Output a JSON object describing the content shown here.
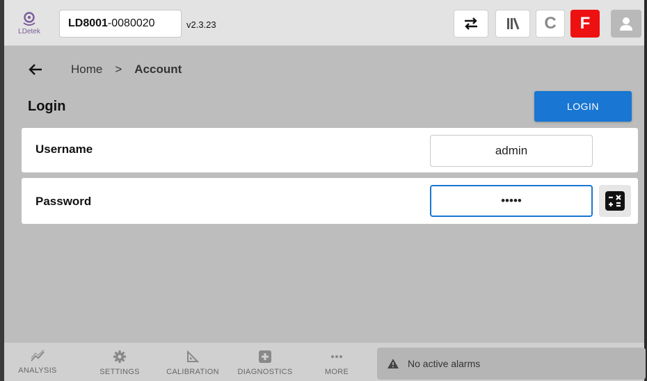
{
  "header": {
    "logo_text": "LDetek",
    "device_model": "LD8001",
    "device_serial": "-0080020",
    "version": "v2.3.23",
    "c_label": "C",
    "f_label": "F",
    "icons": [
      "swap-icon",
      "library-icon",
      "user-icon"
    ],
    "f_color": "#ee1111"
  },
  "breadcrumb": {
    "home": "Home",
    "separator": ">",
    "current": "Account"
  },
  "login": {
    "title": "Login",
    "button_label": "LOGIN",
    "username_label": "Username",
    "username_value": "admin",
    "password_label": "Password",
    "password_value": "•••••"
  },
  "bottom_nav": {
    "items": [
      {
        "label": "ANALYSIS",
        "icon": "chart-line-icon"
      },
      {
        "label": "SETTINGS",
        "icon": "gear-icon"
      },
      {
        "label": "CALIBRATION",
        "icon": "set-square-icon"
      },
      {
        "label": "DIAGNOSTICS",
        "icon": "plus-box-icon"
      },
      {
        "label": "MORE",
        "icon": "ellipsis-icon"
      }
    ],
    "alarm_text": "No active alarms"
  },
  "colors": {
    "accent": "#1976d2",
    "background": "#bdbdbd"
  }
}
